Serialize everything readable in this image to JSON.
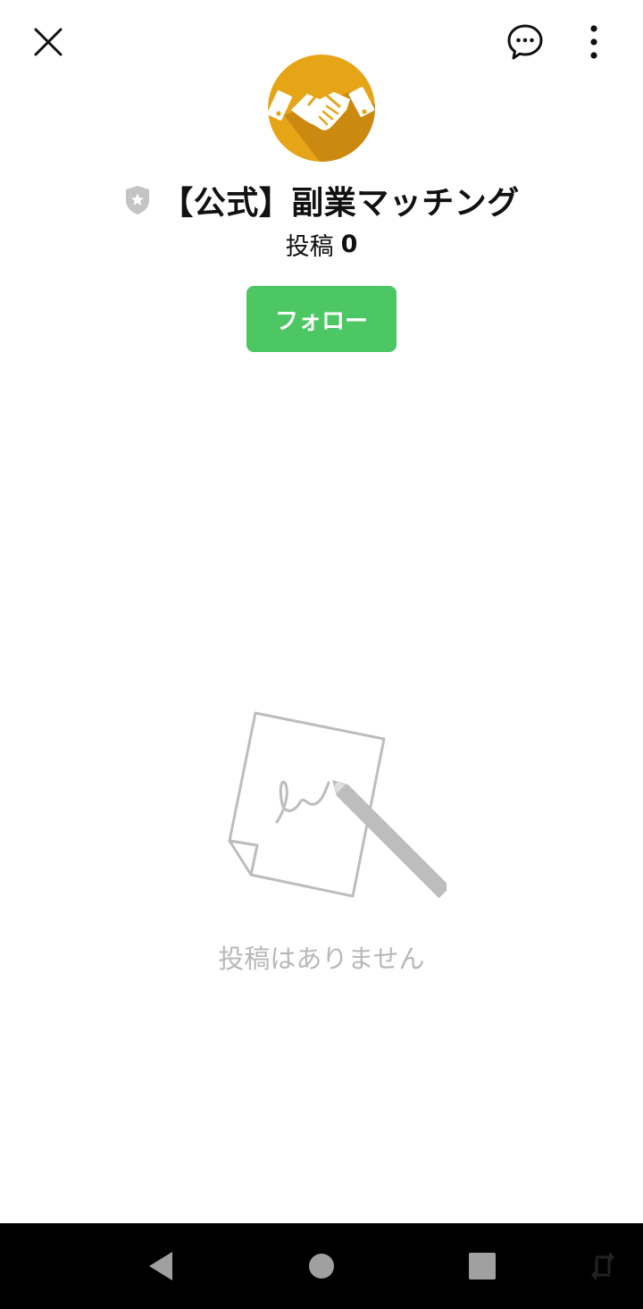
{
  "header": {
    "close_icon": "close-icon",
    "chat_icon": "chat-bubble-icon",
    "more_icon": "more-vertical-icon"
  },
  "profile": {
    "avatar_icon": "handshake-icon",
    "avatar_color": "#E6A417",
    "badge_icon": "official-shield-star-icon",
    "name": "【公式】副業マッチング",
    "posts_label": "投稿",
    "posts_count": "0"
  },
  "actions": {
    "follow_label": "フォロー",
    "follow_color": "#4CC764"
  },
  "empty_state": {
    "illustration_icon": "paper-and-pencil-icon",
    "message": "投稿はありません"
  },
  "system_nav": {
    "back_icon": "back-triangle-icon",
    "home_icon": "home-circle-icon",
    "recents_icon": "recents-square-icon",
    "rotate_icon": "rotate-icon"
  }
}
